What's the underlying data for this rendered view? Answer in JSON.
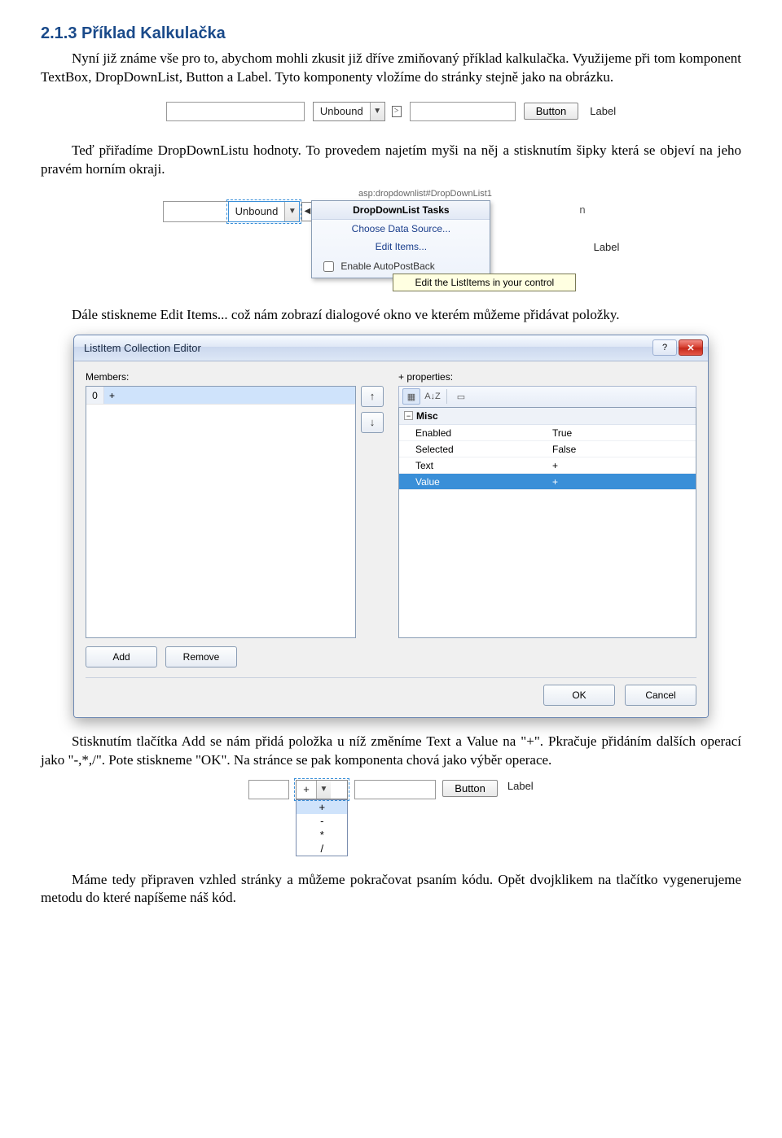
{
  "heading": "2.1.3 Příklad Kalkulačka",
  "para1": "Nyní již známe vše pro to, abychom mohli zkusit již dříve zmiňovaný příklad kalkulačka. Využijeme při tom komponent TextBox, DropDownList, Button a Label. Tyto komponenty vložíme do stránky stejně jako na obrázku.",
  "para2": "Teď přiřadíme DropDownListu hodnoty. To provedem najetím myši na něj a stisknutím šipky která se objeví na jeho pravém horním okraji.",
  "para3": "Dále stiskneme Edit Items... což nám zobrazí dialogové okno ve kterém můžeme přidávat položky.",
  "para4": "Stisknutím tlačítka Add se nám přidá položka u níž změníme Text a Value na \"+\". Pkračuje přidáním dalších operací jako \"-,*,/\". Pote stiskneme \"OK\". Na stránce se pak komponenta chová jako výběr operace.",
  "para5": "Máme tedy připraven vzhled stránky a můžeme pokračovat psaním kódu. Opět dvojklikem na tlačítko vygenerujeme metodu do které napíšeme náš kód.",
  "fig1": {
    "dropdown_text": "Unbound",
    "button_text": "Button",
    "label_text": "Label",
    "smart_tag": ">"
  },
  "fig2": {
    "tag_path": "asp:dropdownlist#DropDownList1",
    "dropdown_text": "Unbound",
    "popup_title": "DropDownList Tasks",
    "item_choose": "Choose Data Source...",
    "item_edit": "Edit Items...",
    "item_enable": "Enable AutoPostBack",
    "button_behind": "n",
    "label_text": "Label",
    "tooltip": "Edit the ListItems in your control"
  },
  "dlg": {
    "title": "ListItem Collection Editor",
    "help": "?",
    "close": "✕",
    "members_label": "Members:",
    "properties_label": "+  properties:",
    "member_index": "0",
    "member_value": "+",
    "up": "↑",
    "down": "↓",
    "tool_cat": "▦",
    "tool_az": "A↓Z",
    "tool_prop": "▭",
    "cat_misc": "Misc",
    "cat_toggle": "−",
    "props": {
      "enabled_name": "Enabled",
      "enabled_val": "True",
      "selected_name": "Selected",
      "selected_val": "False",
      "text_name": "Text",
      "text_val": "+",
      "value_name": "Value",
      "value_val": "+"
    },
    "btn_add": "Add",
    "btn_remove": "Remove",
    "btn_ok": "OK",
    "btn_cancel": "Cancel"
  },
  "fig4": {
    "dropdown_text": "+",
    "button_text": "Button",
    "label_text": "Label",
    "options": [
      "+",
      "-",
      "*",
      "/"
    ]
  }
}
